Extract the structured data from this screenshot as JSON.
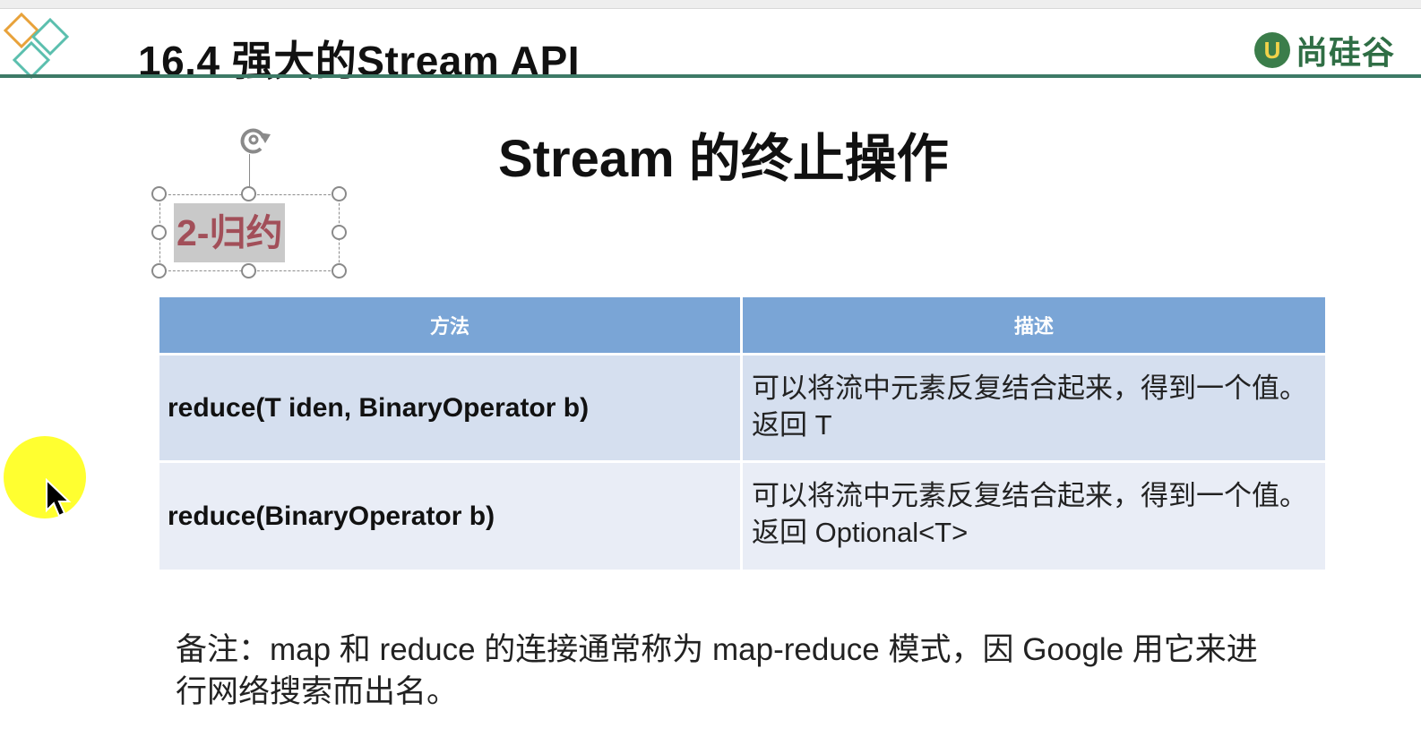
{
  "header": {
    "title": "16.4 强大的Stream API",
    "brand": "尚硅谷",
    "brand_mark": "U"
  },
  "slide": {
    "title": "Stream 的终止操作",
    "subtitle": "2-归约"
  },
  "table": {
    "headers": [
      "方法",
      "描述"
    ],
    "rows": [
      {
        "method": "reduce(T iden, BinaryOperator b)",
        "description": "可以将流中元素反复结合起来，得到一个值。返回 T"
      },
      {
        "method": "reduce(BinaryOperator b)",
        "description": "可以将流中元素反复结合起来，得到一个值。返回 Optional<T>"
      }
    ]
  },
  "note": "备注：map 和 reduce 的连接通常称为 map-reduce 模式，因 Google 用它来进行网络搜索而出名。",
  "colors": {
    "header_rule": "#3d7a66",
    "table_header": "#7aa5d6",
    "row_dark": "#d5dfef",
    "row_light": "#e9edf6",
    "subtitle_text": "#a24f59",
    "brand": "#2f6e45",
    "cursor_highlight": "#ffff1e"
  },
  "icons": [
    "diamond-logo-icon",
    "rotate-handle-icon",
    "mouse-pointer-icon"
  ]
}
